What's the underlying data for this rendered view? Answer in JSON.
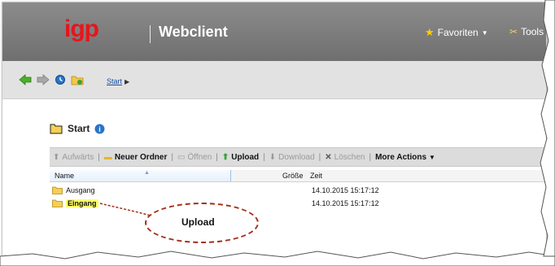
{
  "header": {
    "logo_text": "igp",
    "app_name": "Webclient",
    "favorites_label": "Favoriten",
    "tools_label": "Tools"
  },
  "nav": {
    "breadcrumb": "Start"
  },
  "folder": {
    "title": "Start"
  },
  "toolbar": {
    "up": "Aufwärts",
    "new_folder": "Neuer Ordner",
    "open": "Öffnen",
    "upload": "Upload",
    "download": "Download",
    "delete": "Löschen",
    "more": "More Actions"
  },
  "table": {
    "columns": [
      "Name",
      "Größe",
      "Zeit"
    ],
    "rows": [
      {
        "name": "Ausgang",
        "date": "14.10.2015 15:17:12"
      },
      {
        "name": "Eingang",
        "date": "14.10.2015 15:17:12"
      }
    ]
  },
  "annotation": {
    "label": "Upload"
  },
  "colors": {
    "logo_red": "#e8141b",
    "highlight": "#ffff66",
    "callout": "#a33018"
  }
}
